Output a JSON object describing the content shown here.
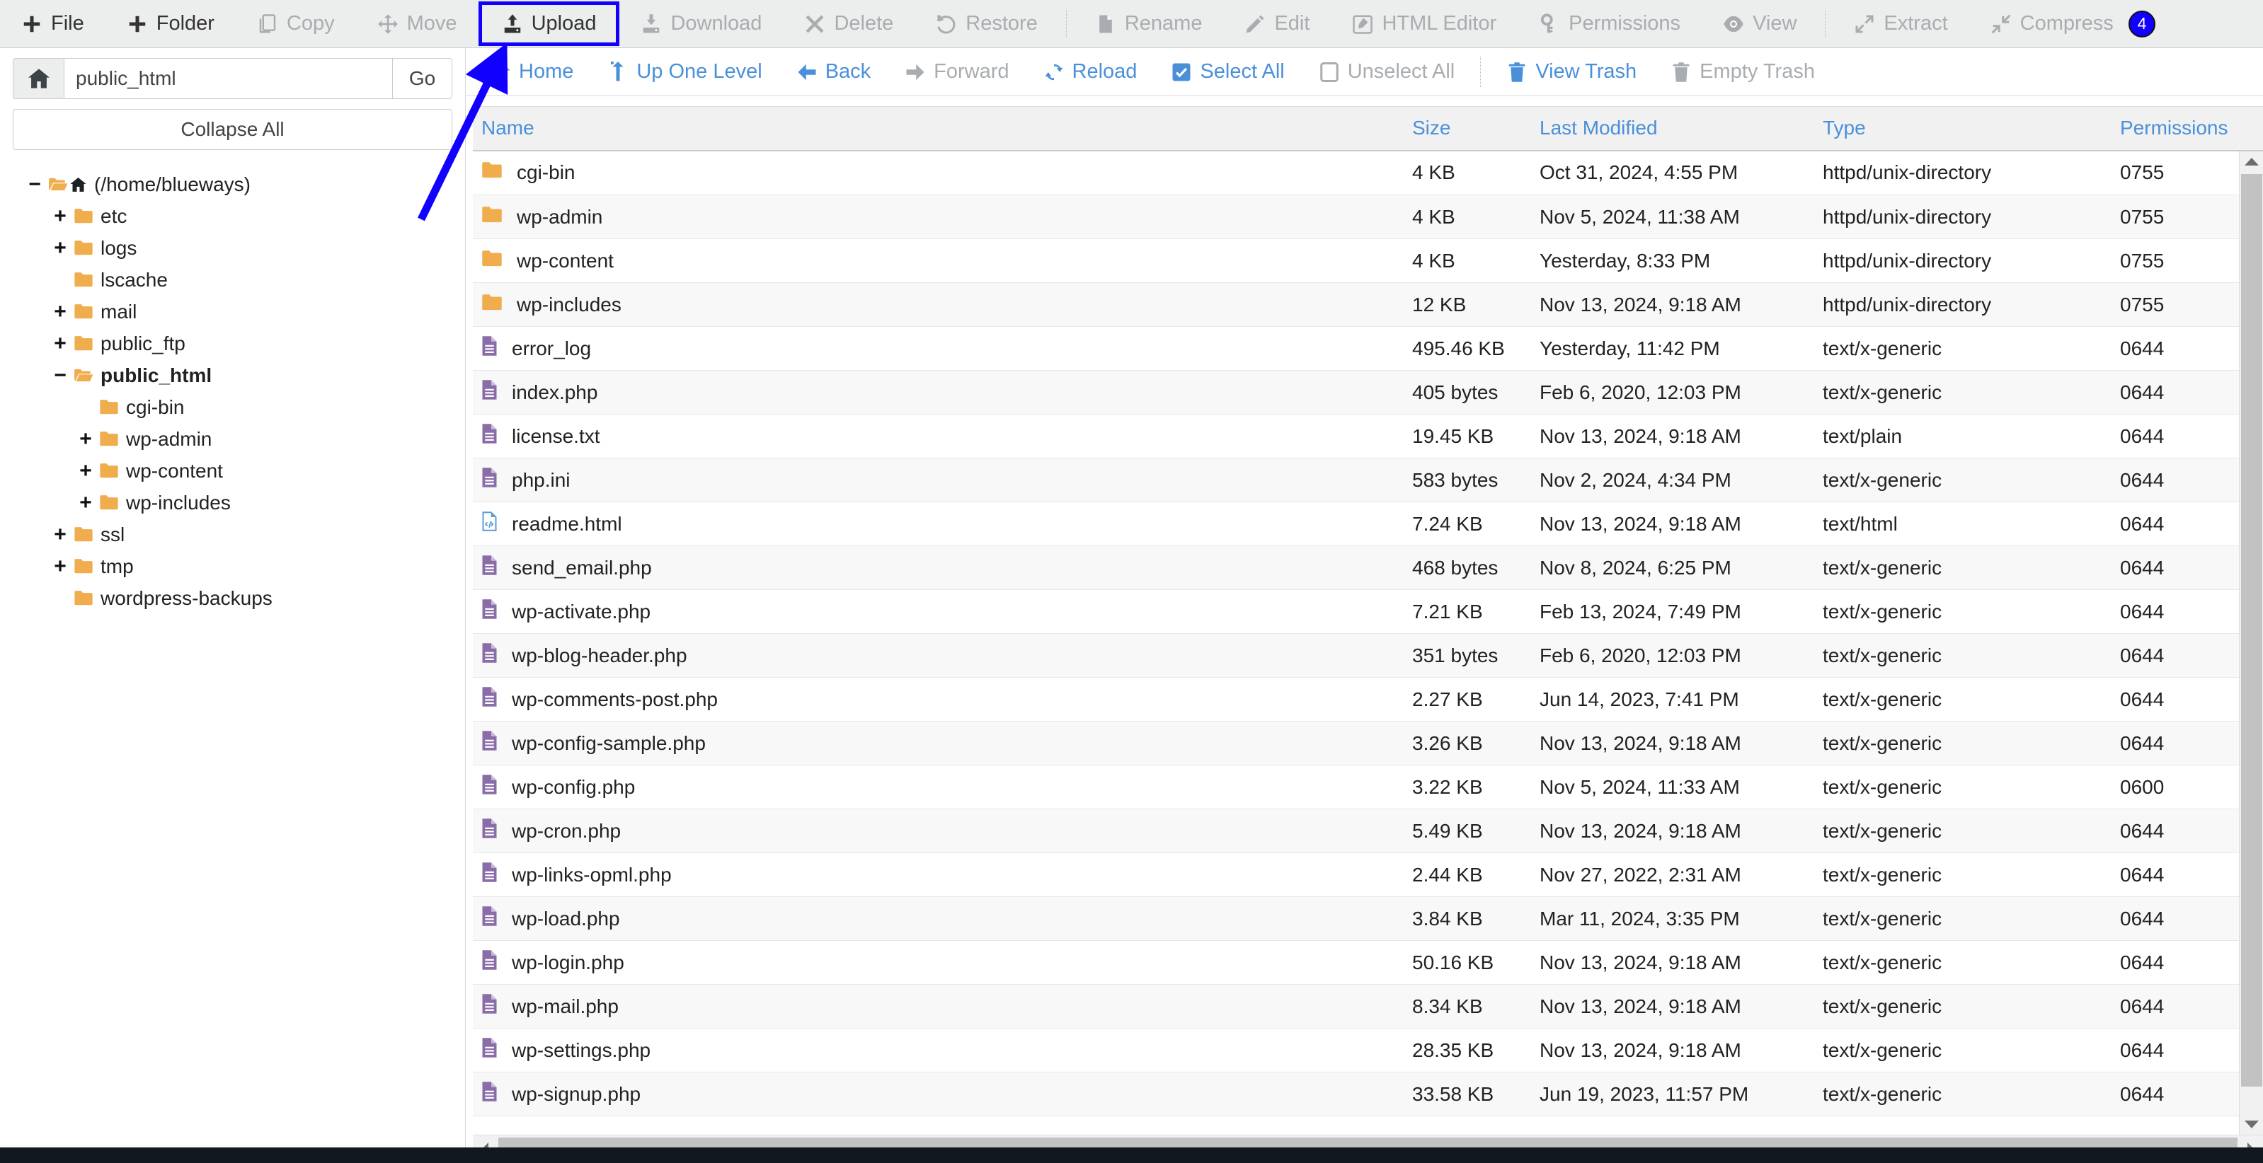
{
  "toolbar": {
    "items": [
      {
        "label": "File",
        "icon": "plus-icon",
        "disabled": false,
        "highlight": false,
        "sep_after": false
      },
      {
        "label": "Folder",
        "icon": "plus-icon",
        "disabled": false,
        "highlight": false,
        "sep_after": false
      },
      {
        "label": "Copy",
        "icon": "copy-icon",
        "disabled": true,
        "highlight": false,
        "sep_after": false
      },
      {
        "label": "Move",
        "icon": "move-icon",
        "disabled": true,
        "highlight": false,
        "sep_after": false
      },
      {
        "label": "Upload",
        "icon": "upload-icon",
        "disabled": false,
        "highlight": true,
        "sep_after": false
      },
      {
        "label": "Download",
        "icon": "download-icon",
        "disabled": true,
        "highlight": false,
        "sep_after": false
      },
      {
        "label": "Delete",
        "icon": "delete-icon",
        "disabled": true,
        "highlight": false,
        "sep_after": false
      },
      {
        "label": "Restore",
        "icon": "restore-icon",
        "disabled": true,
        "highlight": false,
        "sep_after": true
      },
      {
        "label": "Rename",
        "icon": "rename-icon",
        "disabled": true,
        "highlight": false,
        "sep_after": false
      },
      {
        "label": "Edit",
        "icon": "pencil-icon",
        "disabled": true,
        "highlight": false,
        "sep_after": false
      },
      {
        "label": "HTML Editor",
        "icon": "html-editor-icon",
        "disabled": true,
        "highlight": false,
        "sep_after": false
      },
      {
        "label": "Permissions",
        "icon": "key-icon",
        "disabled": true,
        "highlight": false,
        "sep_after": false
      },
      {
        "label": "View",
        "icon": "eye-icon",
        "disabled": true,
        "highlight": false,
        "sep_after": true
      },
      {
        "label": "Extract",
        "icon": "extract-icon",
        "disabled": true,
        "highlight": false,
        "sep_after": false
      },
      {
        "label": "Compress",
        "icon": "compress-icon",
        "disabled": true,
        "highlight": false,
        "sep_after": false
      }
    ],
    "badge": "4",
    "badge_color": "#1200ff",
    "highlight_color": "#1200ff"
  },
  "sidebar": {
    "home_icon": "home-icon",
    "path_value": "public_html",
    "path_placeholder": "",
    "go_label": "Go",
    "collapse_label": "Collapse All",
    "tree": [
      {
        "label": "(/home/blueways)",
        "toggle": "−",
        "indent": 0,
        "icon": "folder-open-home-icon",
        "current": false
      },
      {
        "label": "etc",
        "toggle": "+",
        "indent": 1,
        "icon": "folder-icon",
        "current": false
      },
      {
        "label": "logs",
        "toggle": "+",
        "indent": 1,
        "icon": "folder-icon",
        "current": false
      },
      {
        "label": "lscache",
        "toggle": "",
        "indent": 1,
        "icon": "folder-icon",
        "current": false
      },
      {
        "label": "mail",
        "toggle": "+",
        "indent": 1,
        "icon": "folder-icon",
        "current": false
      },
      {
        "label": "public_ftp",
        "toggle": "+",
        "indent": 1,
        "icon": "folder-icon",
        "current": false
      },
      {
        "label": "public_html",
        "toggle": "−",
        "indent": 1,
        "icon": "folder-open-icon",
        "current": true
      },
      {
        "label": "cgi-bin",
        "toggle": "",
        "indent": 2,
        "icon": "folder-icon",
        "current": false
      },
      {
        "label": "wp-admin",
        "toggle": "+",
        "indent": 2,
        "icon": "folder-icon",
        "current": false
      },
      {
        "label": "wp-content",
        "toggle": "+",
        "indent": 2,
        "icon": "folder-icon",
        "current": false
      },
      {
        "label": "wp-includes",
        "toggle": "+",
        "indent": 2,
        "icon": "folder-icon",
        "current": false
      },
      {
        "label": "ssl",
        "toggle": "+",
        "indent": 1,
        "icon": "folder-icon",
        "current": false
      },
      {
        "label": "tmp",
        "toggle": "+",
        "indent": 1,
        "icon": "folder-icon",
        "current": false
      },
      {
        "label": "wordpress-backups",
        "toggle": "",
        "indent": 1,
        "icon": "folder-icon",
        "current": false
      }
    ]
  },
  "navbar": {
    "items": [
      {
        "label": "Home",
        "icon": "home-icon",
        "disabled": false,
        "sep_after": false
      },
      {
        "label": "Up One Level",
        "icon": "up-level-icon",
        "disabled": false,
        "sep_after": false
      },
      {
        "label": "Back",
        "icon": "arrow-left-icon",
        "disabled": false,
        "sep_after": false
      },
      {
        "label": "Forward",
        "icon": "arrow-right-icon",
        "disabled": true,
        "sep_after": false
      },
      {
        "label": "Reload",
        "icon": "reload-icon",
        "disabled": false,
        "sep_after": false
      },
      {
        "label": "Select All",
        "icon": "checkbox-checked-icon",
        "disabled": false,
        "sep_after": false
      },
      {
        "label": "Unselect All",
        "icon": "checkbox-empty-icon",
        "disabled": true,
        "sep_after": true
      },
      {
        "label": "View Trash",
        "icon": "trash-icon",
        "disabled": false,
        "sep_after": false
      },
      {
        "label": "Empty Trash",
        "icon": "trash-icon",
        "disabled": true,
        "sep_after": false
      }
    ]
  },
  "table": {
    "columns": [
      "Name",
      "Size",
      "Last Modified",
      "Type",
      "Permissions"
    ],
    "rows": [
      {
        "name": "cgi-bin",
        "icon": "folder-icon",
        "size": "4 KB",
        "modified": "Oct 31, 2024, 4:55 PM",
        "type": "httpd/unix-directory",
        "permissions": "0755"
      },
      {
        "name": "wp-admin",
        "icon": "folder-icon",
        "size": "4 KB",
        "modified": "Nov 5, 2024, 11:38 AM",
        "type": "httpd/unix-directory",
        "permissions": "0755"
      },
      {
        "name": "wp-content",
        "icon": "folder-icon",
        "size": "4 KB",
        "modified": "Yesterday, 8:33 PM",
        "type": "httpd/unix-directory",
        "permissions": "0755"
      },
      {
        "name": "wp-includes",
        "icon": "folder-icon",
        "size": "12 KB",
        "modified": "Nov 13, 2024, 9:18 AM",
        "type": "httpd/unix-directory",
        "permissions": "0755"
      },
      {
        "name": "error_log",
        "icon": "file-icon",
        "size": "495.46 KB",
        "modified": "Yesterday, 11:42 PM",
        "type": "text/x-generic",
        "permissions": "0644"
      },
      {
        "name": "index.php",
        "icon": "file-icon",
        "size": "405 bytes",
        "modified": "Feb 6, 2020, 12:03 PM",
        "type": "text/x-generic",
        "permissions": "0644"
      },
      {
        "name": "license.txt",
        "icon": "file-icon",
        "size": "19.45 KB",
        "modified": "Nov 13, 2024, 9:18 AM",
        "type": "text/plain",
        "permissions": "0644"
      },
      {
        "name": "php.ini",
        "icon": "file-icon",
        "size": "583 bytes",
        "modified": "Nov 2, 2024, 4:34 PM",
        "type": "text/x-generic",
        "permissions": "0644"
      },
      {
        "name": "readme.html",
        "icon": "html-file-icon",
        "size": "7.24 KB",
        "modified": "Nov 13, 2024, 9:18 AM",
        "type": "text/html",
        "permissions": "0644"
      },
      {
        "name": "send_email.php",
        "icon": "file-icon",
        "size": "468 bytes",
        "modified": "Nov 8, 2024, 6:25 PM",
        "type": "text/x-generic",
        "permissions": "0644"
      },
      {
        "name": "wp-activate.php",
        "icon": "file-icon",
        "size": "7.21 KB",
        "modified": "Feb 13, 2024, 7:49 PM",
        "type": "text/x-generic",
        "permissions": "0644"
      },
      {
        "name": "wp-blog-header.php",
        "icon": "file-icon",
        "size": "351 bytes",
        "modified": "Feb 6, 2020, 12:03 PM",
        "type": "text/x-generic",
        "permissions": "0644"
      },
      {
        "name": "wp-comments-post.php",
        "icon": "file-icon",
        "size": "2.27 KB",
        "modified": "Jun 14, 2023, 7:41 PM",
        "type": "text/x-generic",
        "permissions": "0644"
      },
      {
        "name": "wp-config-sample.php",
        "icon": "file-icon",
        "size": "3.26 KB",
        "modified": "Nov 13, 2024, 9:18 AM",
        "type": "text/x-generic",
        "permissions": "0644"
      },
      {
        "name": "wp-config.php",
        "icon": "file-icon",
        "size": "3.22 KB",
        "modified": "Nov 5, 2024, 11:33 AM",
        "type": "text/x-generic",
        "permissions": "0600"
      },
      {
        "name": "wp-cron.php",
        "icon": "file-icon",
        "size": "5.49 KB",
        "modified": "Nov 13, 2024, 9:18 AM",
        "type": "text/x-generic",
        "permissions": "0644"
      },
      {
        "name": "wp-links-opml.php",
        "icon": "file-icon",
        "size": "2.44 KB",
        "modified": "Nov 27, 2022, 2:31 AM",
        "type": "text/x-generic",
        "permissions": "0644"
      },
      {
        "name": "wp-load.php",
        "icon": "file-icon",
        "size": "3.84 KB",
        "modified": "Mar 11, 2024, 3:35 PM",
        "type": "text/x-generic",
        "permissions": "0644"
      },
      {
        "name": "wp-login.php",
        "icon": "file-icon",
        "size": "50.16 KB",
        "modified": "Nov 13, 2024, 9:18 AM",
        "type": "text/x-generic",
        "permissions": "0644"
      },
      {
        "name": "wp-mail.php",
        "icon": "file-icon",
        "size": "8.34 KB",
        "modified": "Nov 13, 2024, 9:18 AM",
        "type": "text/x-generic",
        "permissions": "0644"
      },
      {
        "name": "wp-settings.php",
        "icon": "file-icon",
        "size": "28.35 KB",
        "modified": "Nov 13, 2024, 9:18 AM",
        "type": "text/x-generic",
        "permissions": "0644"
      },
      {
        "name": "wp-signup.php",
        "icon": "file-icon",
        "size": "33.58 KB",
        "modified": "Jun 19, 2023, 11:57 PM",
        "type": "text/x-generic",
        "permissions": "0644"
      }
    ]
  },
  "annotation": {
    "arrow_color": "#1200ff",
    "points_to": "Upload"
  },
  "colors": {
    "folder": "#f0ad4e",
    "file": "#8a6ca8",
    "html_file": "#5b9bd5",
    "link": "#4a90d9",
    "toolbar_bg": "#eceded",
    "disabled_text": "#a9adb0"
  }
}
